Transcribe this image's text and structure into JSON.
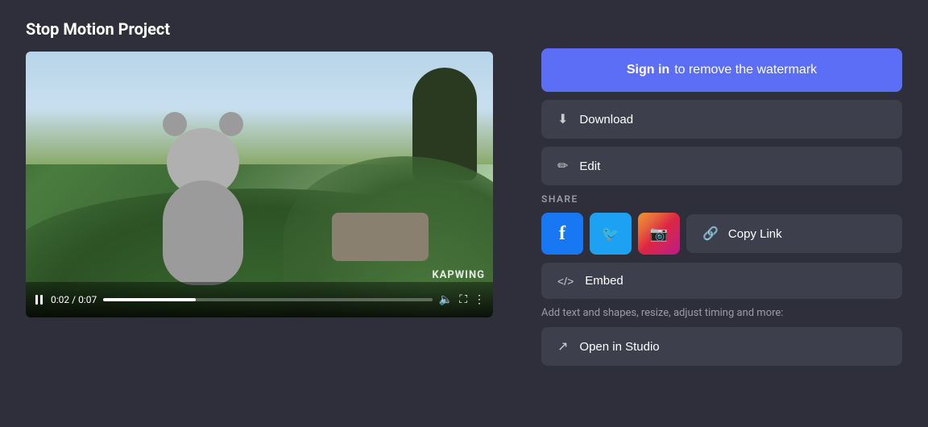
{
  "page": {
    "title": "Stop Motion Project",
    "bg_color": "#2e2f3a"
  },
  "video": {
    "time_current": "0:02",
    "time_total": "0:07",
    "progress_percent": 28,
    "watermark": "KAPWING"
  },
  "sidebar": {
    "sign_in_btn": {
      "bold": "Sign in",
      "normal": "to remove the watermark"
    },
    "download_label": "Download",
    "edit_label": "Edit",
    "share_label": "SHARE",
    "copy_link_label": "Copy Link",
    "embed_label": "Embed",
    "add_tools_label": "Add text and shapes, resize, adjust timing and more:",
    "open_studio_label": "Open in Studio"
  },
  "social": {
    "facebook_label": "f",
    "twitter_label": "t",
    "instagram_label": "ig"
  }
}
